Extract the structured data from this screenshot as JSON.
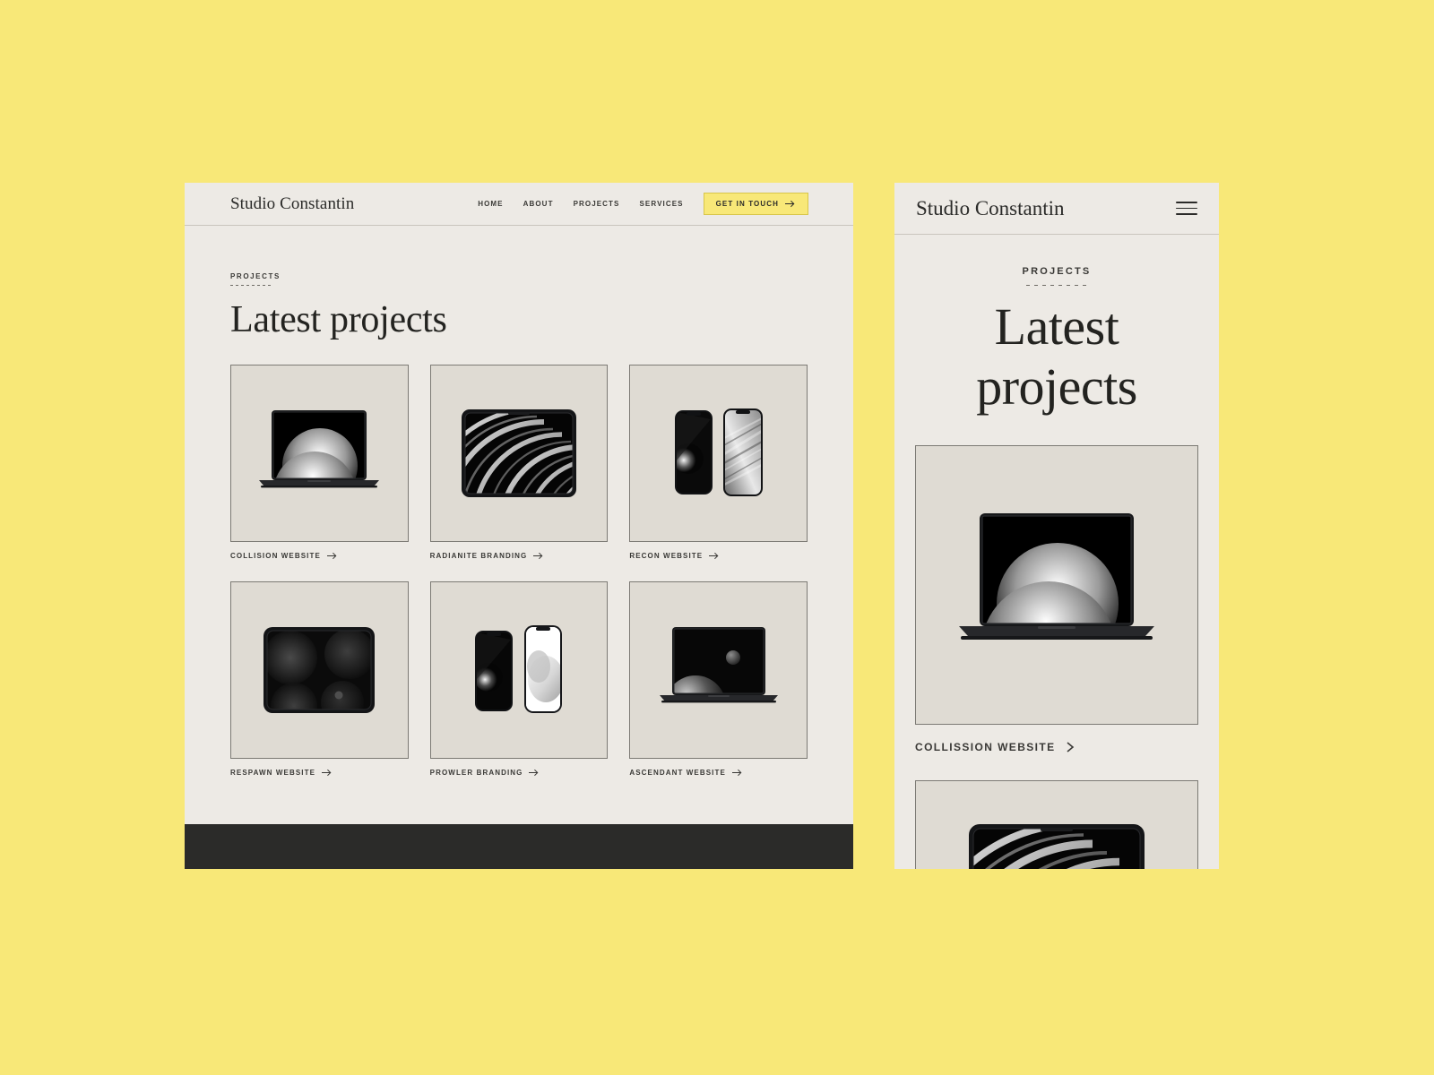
{
  "canvas": {
    "background_color": "#F8E878"
  },
  "desktop": {
    "brand": "Studio Constantin",
    "nav": [
      {
        "label": "HOME"
      },
      {
        "label": "ABOUT"
      },
      {
        "label": "PROJECTS"
      },
      {
        "label": "SERVICES"
      }
    ],
    "cta": {
      "label": "GET IN TOUCH",
      "icon": "arrow-right-icon",
      "background_color": "#F8E878"
    },
    "eyebrow": "PROJECTS",
    "title": "Latest projects",
    "projects": [
      {
        "caption": "COLLISION WEBSITE",
        "icon": "arrow-right-icon",
        "artwork": "laptop-two-spheres"
      },
      {
        "caption": "RADIANITE BRANDING",
        "icon": "arrow-right-icon",
        "artwork": "tablet-diagonal-stripes"
      },
      {
        "caption": "RECON WEBSITE",
        "icon": "arrow-right-icon",
        "artwork": "two-phones-dark-light"
      },
      {
        "caption": "RESPAWN WEBSITE",
        "icon": "arrow-right-icon",
        "artwork": "tablet-dark-blobs"
      },
      {
        "caption": "PROWLER BRANDING",
        "icon": "arrow-right-icon",
        "artwork": "two-phones-dark-white"
      },
      {
        "caption": "ASCENDANT WEBSITE",
        "icon": "arrow-right-icon",
        "artwork": "laptop-planet-moon"
      }
    ],
    "footer_color": "#2B2B29"
  },
  "mobile": {
    "brand": "Studio Constantin",
    "menu_icon": "hamburger-menu-icon",
    "eyebrow": "PROJECTS",
    "title": "Latest projects",
    "projects": [
      {
        "caption": "COLLISSION WEBSITE",
        "icon": "chevron-right-icon",
        "artwork": "laptop-two-spheres"
      },
      {
        "caption": "",
        "icon": "",
        "artwork": "tablet-diagonal-stripes"
      }
    ]
  }
}
